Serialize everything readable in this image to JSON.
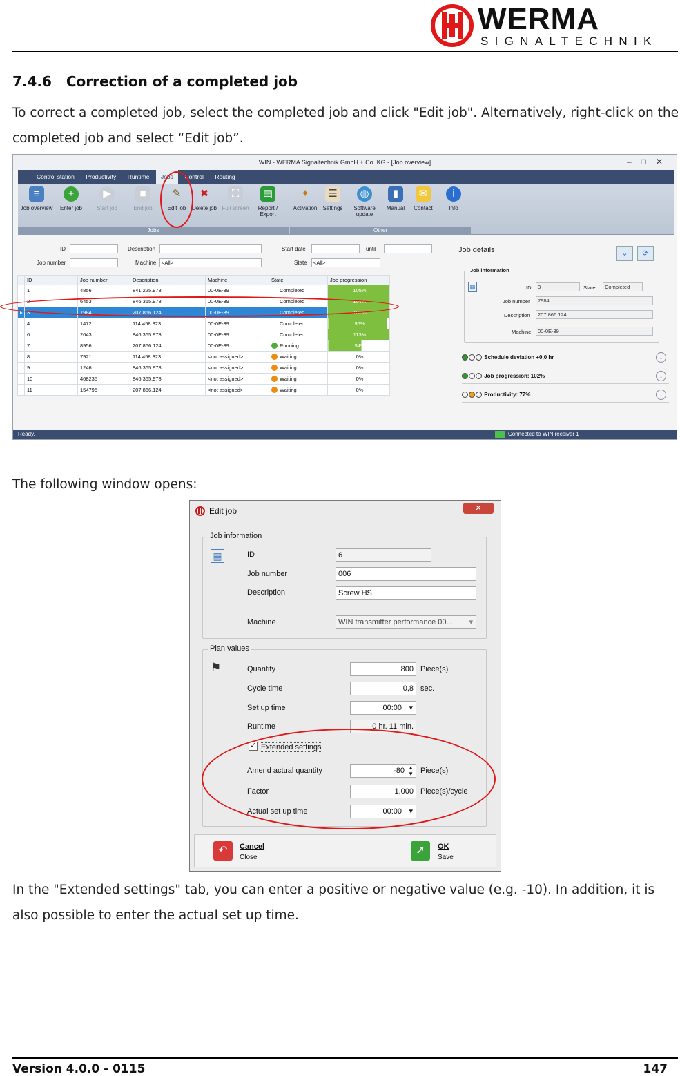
{
  "header": {
    "brand": "WERMA",
    "subbrand": "SIGNALTECHNIK",
    "logo_icon": "werma-logo-icon",
    "accent_color": "#e01818"
  },
  "section": {
    "number": "7.4.6",
    "title": "Correction of a completed job"
  },
  "intro": "To correct a completed job, select the completed job and click \"Edit job\". Alternatively, right-click on the completed job and select “Edit job”.",
  "following": "The following window opens:",
  "outro": "In the \"Extended settings\" tab, you can enter a positive or negative value (e.g. -10). In addition, it is also possible to enter the actual set up time.",
  "app": {
    "title": "WIN - WERMA Signaltechnik GmbH + Co. KG - [Job overview]",
    "menu": [
      "Control station",
      "Productivity",
      "Runtime",
      "Jobs",
      "Control",
      "Routing"
    ],
    "ribbon": {
      "jobs_group": "Jobs",
      "other_group": "Other",
      "buttons": [
        "Job overview",
        "Enter job",
        "Start job",
        "End job",
        "Edit job",
        "Delete job",
        "Full screen",
        "Report / Export",
        "Activation",
        "Settings",
        "Software update",
        "Manual",
        "Contact",
        "Info"
      ]
    },
    "filters": {
      "id": "ID",
      "description": "Description",
      "start_date": "Start date",
      "until": "until",
      "job_number": "Job number",
      "machine": "Machine",
      "machine_value": "<All>",
      "state": "State",
      "state_value": "<All>"
    },
    "columns": [
      "ID",
      "Job number",
      "Description",
      "Machine",
      "State",
      "Job progression"
    ],
    "rows": [
      {
        "id": "1",
        "job": "4856",
        "desc": "841.225.978",
        "machine": "00-0E-39",
        "state": "Completed",
        "progress": "105%",
        "fill": 1.0
      },
      {
        "id": "2",
        "job": "6453",
        "desc": "846.365.978",
        "machine": "00-0E-39",
        "state": "Completed",
        "progress": "104%",
        "fill": 1.0
      },
      {
        "id": "3",
        "job": "7984",
        "desc": "207.866.124",
        "machine": "00-0E-39",
        "state": "Completed",
        "progress": "102%",
        "fill": 1.0
      },
      {
        "id": "4",
        "job": "1472",
        "desc": "114.458.323",
        "machine": "00-0E-39",
        "state": "Completed",
        "progress": "96%",
        "fill": 0.96
      },
      {
        "id": "6",
        "job": "2643",
        "desc": "846.365.978",
        "machine": "00-0E-39",
        "state": "Completed",
        "progress": "113%",
        "fill": 1.0
      },
      {
        "id": "7",
        "job": "8956",
        "desc": "207.866.124",
        "machine": "00-0E-39",
        "state": "Running",
        "progress": "54%",
        "fill": 0.54
      },
      {
        "id": "8",
        "job": "7921",
        "desc": "114.458.323",
        "machine": "<not assigned>",
        "state": "Waiting",
        "progress": "0%",
        "fill": 0
      },
      {
        "id": "9",
        "job": "1246",
        "desc": "846.365.978",
        "machine": "<not assigned>",
        "state": "Waiting",
        "progress": "0%",
        "fill": 0
      },
      {
        "id": "10",
        "job": "468235",
        "desc": "846.365.978",
        "machine": "<not assigned>",
        "state": "Waiting",
        "progress": "0%",
        "fill": 0
      },
      {
        "id": "11",
        "job": "154795",
        "desc": "207.866.124",
        "machine": "<not assigned>",
        "state": "Waiting",
        "progress": "0%",
        "fill": 0
      }
    ],
    "details": {
      "title": "Job details",
      "group": "Job information",
      "id_label": "ID",
      "id_value": "3",
      "state_label": "State",
      "state_value": "Completed",
      "job_label": "Job number",
      "job_value": "7984",
      "desc_label": "Description",
      "desc_value": "207.866.124",
      "machine_label": "Machine",
      "machine_value": "00-0E-39",
      "kpis": [
        "Schedule deviation +0,0 hr",
        "Job progression: 102%",
        "Productivity: 77%"
      ]
    },
    "status": {
      "left": "Ready.",
      "right": "Connected to WIN receiver 1"
    }
  },
  "dialog": {
    "title": "Edit job",
    "job_info": "Job information",
    "id_label": "ID",
    "id_value": "6",
    "job_label": "Job number",
    "job_value": "006",
    "desc_label": "Description",
    "desc_value": "Screw HS",
    "machine_label": "Machine",
    "machine_value": "WIN transmitter performance 00...",
    "plan": "Plan values",
    "qty_label": "Quantity",
    "qty_value": "800",
    "qty_unit": "Piece(s)",
    "cycle_label": "Cycle time",
    "cycle_value": "0,8",
    "cycle_unit": "sec.",
    "setup_label": "Set up time",
    "setup_value": "00:00",
    "runtime_label": "Runtime",
    "runtime_value": "0 hr. 11 min.",
    "ext_label": "Extended settings",
    "amend_label": "Amend actual quantity",
    "amend_value": "-80",
    "amend_unit": "Piece(s)",
    "factor_label": "Factor",
    "factor_value": "1,000",
    "factor_unit": "Piece(s)/cycle",
    "actual_label": "Actual set up time",
    "actual_value": "00:00",
    "cancel": "Cancel",
    "cancel_sub": "Close",
    "ok": "OK",
    "ok_sub": "Save"
  },
  "footer": {
    "version": "Version 4.0.0 - 0115",
    "page": "147"
  }
}
